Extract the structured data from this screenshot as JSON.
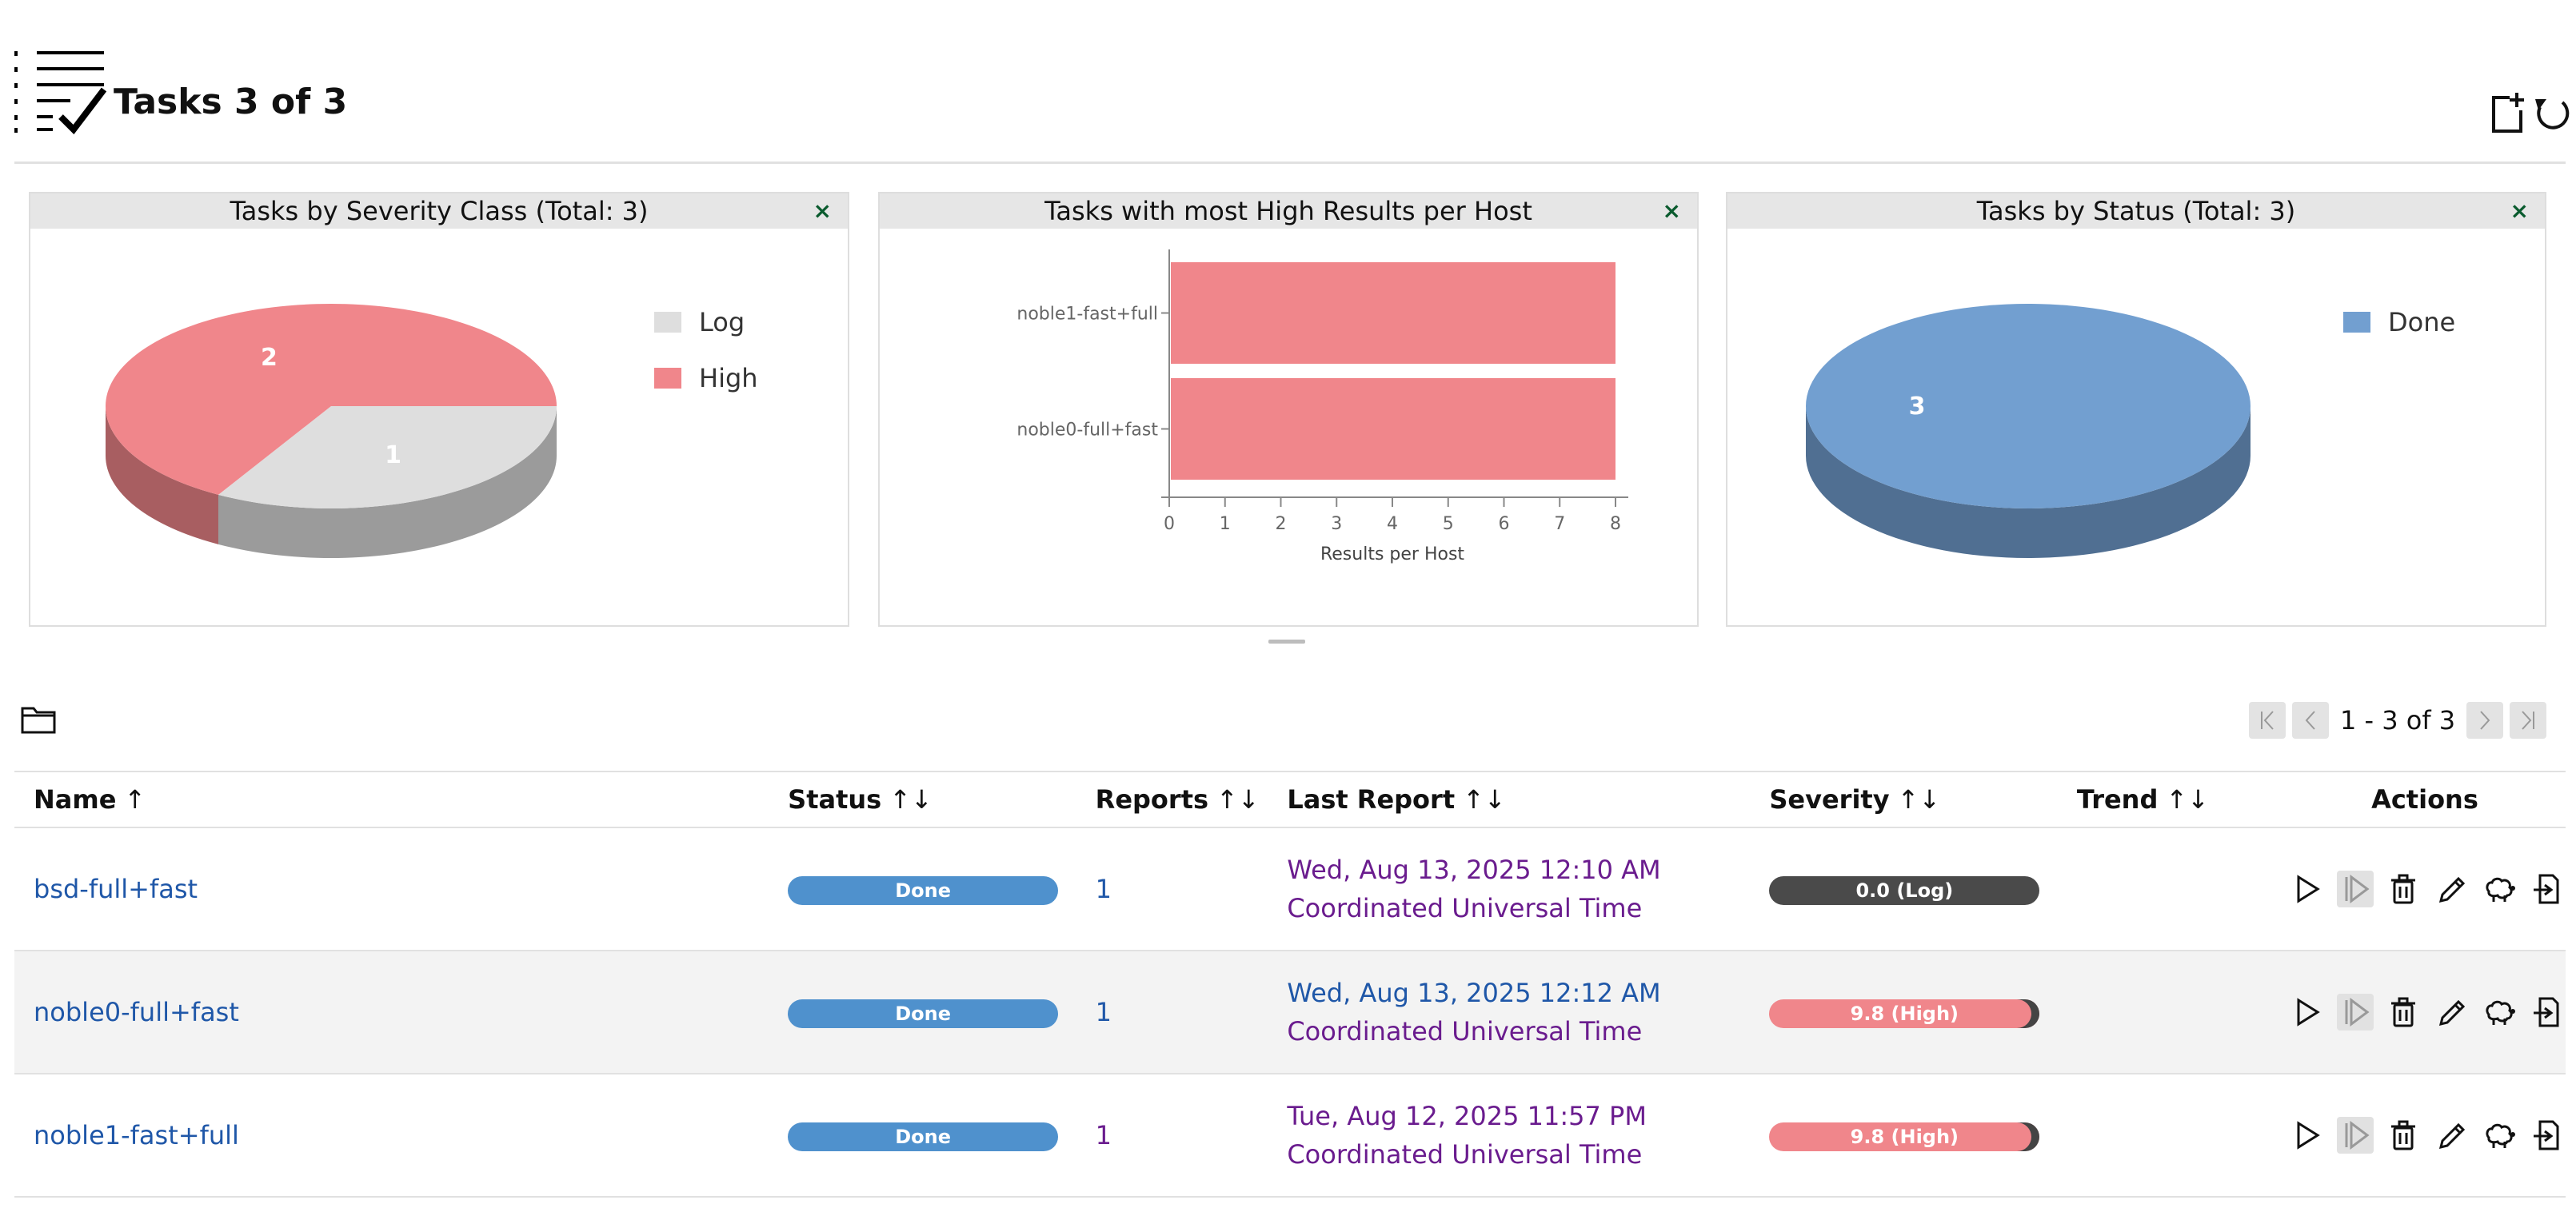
{
  "header": {
    "title": "Tasks 3 of 3",
    "icons": [
      "task-list-icon",
      "new-task-icon",
      "refresh-icon"
    ]
  },
  "dashboard": {
    "charts": [
      {
        "title": "Tasks by Severity Class (Total: 3)",
        "close_label": "×"
      },
      {
        "title": "Tasks with most High Results per Host",
        "close_label": "×"
      },
      {
        "title": "Tasks by Status (Total: 3)",
        "close_label": "×"
      }
    ]
  },
  "chart_data": [
    {
      "type": "pie",
      "title": "Tasks by Severity Class (Total: 3)",
      "slices": [
        {
          "label": "Log",
          "value": 1,
          "color": "#dedede"
        },
        {
          "label": "High",
          "value": 2,
          "color": "#f0868b"
        }
      ],
      "legend": [
        "Log",
        "High"
      ],
      "legend_position": "top-right"
    },
    {
      "type": "bar",
      "orientation": "horizontal",
      "title": "Tasks with most High Results per Host",
      "categories": [
        "noble1-fast+full",
        "noble0-full+fast"
      ],
      "values": [
        8,
        8
      ],
      "xlabel": "Results per Host",
      "xlim": [
        0,
        8
      ],
      "ticks": [
        "0",
        "1",
        "2",
        "3",
        "4",
        "5",
        "6",
        "7",
        "8"
      ],
      "color": "#f0868b"
    },
    {
      "type": "pie",
      "title": "Tasks by Status (Total: 3)",
      "slices": [
        {
          "label": "Done",
          "value": 3,
          "color": "#729fd0"
        }
      ],
      "legend": [
        "Done"
      ],
      "legend_position": "top-right"
    }
  ],
  "pagination": {
    "info": "1 - 3 of 3"
  },
  "table": {
    "columns": [
      {
        "label": "Name",
        "sort": "↑"
      },
      {
        "label": "Status",
        "sort": "↑↓"
      },
      {
        "label": "Reports",
        "sort": "↑↓"
      },
      {
        "label": "Last Report",
        "sort": "↑↓"
      },
      {
        "label": "Severity",
        "sort": "↑↓"
      },
      {
        "label": "Trend",
        "sort": "↑↓"
      },
      {
        "label": "Actions",
        "sort": ""
      }
    ],
    "rows": [
      {
        "name": "bsd-full+fast",
        "status": "Done",
        "reports": "1",
        "last_report_date": "Wed, Aug 13, 2025 12:10 AM",
        "last_report_tz": "Coordinated Universal Time",
        "severity": "0.0 (Log)"
      },
      {
        "name": "noble0-full+fast",
        "status": "Done",
        "reports": "1",
        "last_report_date": "Wed, Aug 13, 2025 12:12 AM",
        "last_report_tz": "Coordinated Universal Time",
        "severity": "9.8 (High)"
      },
      {
        "name": "noble1-fast+full",
        "status": "Done",
        "reports": "1",
        "last_report_date": "Tue, Aug 12, 2025 11:57 PM",
        "last_report_tz": "Coordinated Universal Time",
        "severity": "9.8 (High)"
      }
    ]
  },
  "colors": {
    "link": "#1f57a8",
    "visited": "#6a1c8e",
    "status_done": "#4f91cd",
    "severity_high": "#f0868b",
    "severity_log": "#4a4a4a"
  }
}
